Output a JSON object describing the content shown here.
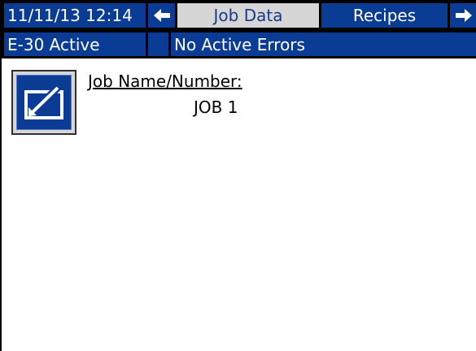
{
  "header": {
    "datetime": "11/11/13 12:14",
    "tabs": [
      {
        "label": "Job Data",
        "selected": true
      },
      {
        "label": "Recipes",
        "selected": false
      }
    ],
    "nav_left_icon": "left-arrow-icon",
    "nav_right_icon": "right-arrow-icon"
  },
  "status_bar": {
    "mode": "E-30 Active",
    "errors": "No Active Errors"
  },
  "job": {
    "label": "Job Name/Number:",
    "value": "JOB 1",
    "edit_icon": "edit-icon"
  },
  "colors": {
    "accent": "#0a3c96",
    "selected_tab": "#d6d6d6",
    "bar_background": "#000000",
    "screen_background": "#ffffff"
  }
}
